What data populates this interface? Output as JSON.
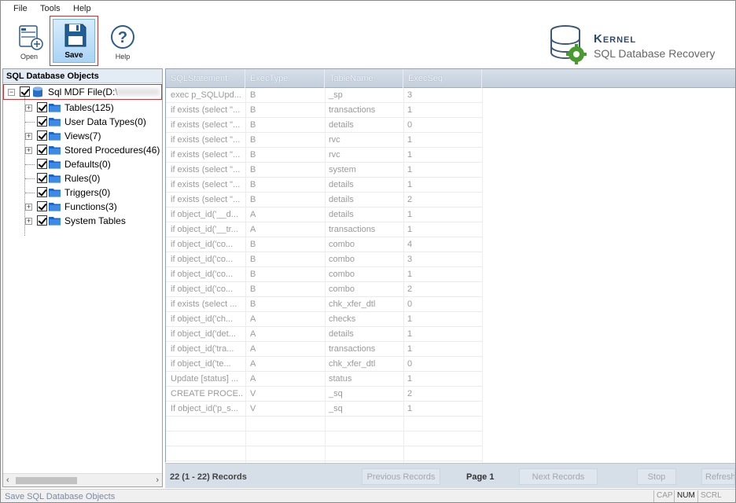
{
  "menu": [
    "File",
    "Tools",
    "Help"
  ],
  "toolbar": {
    "open": "Open",
    "save": "Save",
    "help": "Help"
  },
  "logo": {
    "brand": "Kernel",
    "product": "SQL Database Recovery",
    "accent": "#4a9b2f"
  },
  "tree": {
    "header": "SQL Database Objects",
    "root": "Sql MDF File(D:\\",
    "items": [
      {
        "label": "Tables(125)",
        "expandable": true
      },
      {
        "label": "User Data Types(0)",
        "expandable": false
      },
      {
        "label": "Views(7)",
        "expandable": true
      },
      {
        "label": "Stored Procedures(46)",
        "expandable": true
      },
      {
        "label": "Defaults(0)",
        "expandable": false
      },
      {
        "label": "Rules(0)",
        "expandable": false
      },
      {
        "label": "Triggers(0)",
        "expandable": false
      },
      {
        "label": "Functions(3)",
        "expandable": true
      },
      {
        "label": "System Tables",
        "expandable": true
      }
    ]
  },
  "grid": {
    "columns": [
      "SQLStatement",
      "ExecType",
      "TableName",
      "ExecSeq"
    ],
    "rows": [
      [
        "exec p_SQLUpd...",
        "B",
        "_sp",
        "3"
      ],
      [
        "if exists (select \"...",
        "B",
        "transactions",
        "1"
      ],
      [
        "if exists (select \"...",
        "B",
        "details",
        "0"
      ],
      [
        "if exists (select \"...",
        "B",
        "rvc",
        "1"
      ],
      [
        "if exists (select \"...",
        "B",
        "rvc",
        "1"
      ],
      [
        "if exists (select \"...",
        "B",
        "system",
        "1"
      ],
      [
        "if exists (select \"...",
        "B",
        "details",
        "1"
      ],
      [
        "if exists (select \"...",
        "B",
        "details",
        "2"
      ],
      [
        "if object_id('__d...",
        "A",
        "details",
        "1"
      ],
      [
        "if object_id('__tr...",
        "A",
        "transactions",
        "1"
      ],
      [
        "if object_id('co...",
        "B",
        "combo",
        "4"
      ],
      [
        "if object_id('co...",
        "B",
        "combo",
        "3"
      ],
      [
        "if object_id('co...",
        "B",
        "combo",
        "1"
      ],
      [
        "if object_id('co...",
        "B",
        "combo",
        "2"
      ],
      [
        "if exists (select ...",
        "B",
        "chk_xfer_dtl",
        "0"
      ],
      [
        "if object_id('ch...",
        "A",
        "checks",
        "1"
      ],
      [
        "if object_id('det...",
        "A",
        "details",
        "1"
      ],
      [
        "if object_id('tra...",
        "A",
        "transactions",
        "1"
      ],
      [
        "if object_id('te...",
        "A",
        "chk_xfer_dtl",
        "0"
      ],
      [
        "Update [status] ...",
        "A",
        "status",
        "1"
      ],
      [
        "CREATE PROCE...",
        "V",
        "_sq",
        "2"
      ],
      [
        "If object_id('p_s...",
        "V",
        "_sq",
        "1"
      ]
    ]
  },
  "pager": {
    "count": "22 (1 - 22) Records",
    "prev": "Previous Records",
    "page": "Page 1",
    "next": "Next Records",
    "stop": "Stop",
    "refresh": "Refresh"
  },
  "status": {
    "message": "Save SQL Database Objects",
    "indicators": [
      {
        "label": "CAP",
        "on": false
      },
      {
        "label": "NUM",
        "on": true
      },
      {
        "label": "SCRL",
        "on": false
      }
    ]
  }
}
